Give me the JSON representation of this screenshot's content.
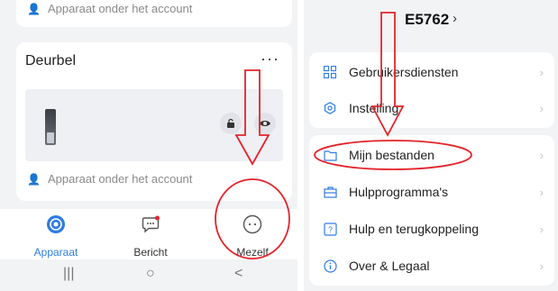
{
  "left": {
    "previous_card": {
      "account_text": "Apparaat onder het account"
    },
    "device": {
      "title": "Deurbel",
      "more_glyph": "···",
      "account_text": "Apparaat onder het account"
    },
    "tabs": [
      {
        "label": "Apparaat",
        "icon": "apparaat-icon",
        "active": true
      },
      {
        "label": "Bericht",
        "icon": "message-icon",
        "active": false
      },
      {
        "label": "Mezelf",
        "icon": "profile-icon",
        "active": false
      }
    ],
    "nav": {
      "recent": "|||",
      "home": "○",
      "back": "<"
    }
  },
  "right": {
    "header": {
      "title": "E5762",
      "chevron": "›"
    },
    "menu_top": [
      {
        "label": "Gebruikersdiensten",
        "icon": "grid-icon"
      },
      {
        "label": "Instelling",
        "icon": "hexagon-settings-icon"
      }
    ],
    "menu_bottom": [
      {
        "label": "Mijn bestanden",
        "icon": "folder-icon"
      },
      {
        "label": "Hulpprogramma's",
        "icon": "toolbox-icon"
      },
      {
        "label": "Hulp en terugkoppeling",
        "icon": "help-icon"
      },
      {
        "label": "Over & Legaal",
        "icon": "info-icon"
      }
    ],
    "menu_chevron": "›"
  },
  "colors": {
    "accent": "#2f7de1",
    "annotation": "#e3242b",
    "background": "#f2f3f5"
  }
}
